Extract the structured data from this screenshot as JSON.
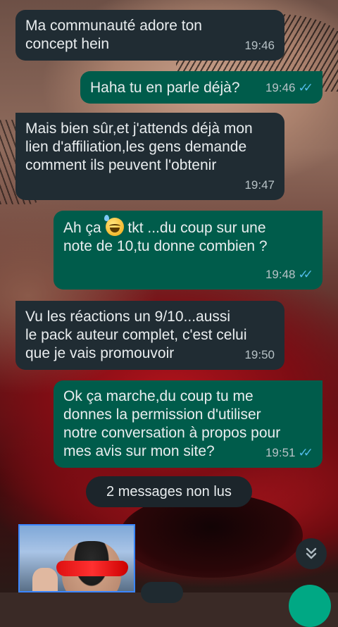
{
  "messages": [
    {
      "direction": "in",
      "text": "Ma communauté adore ton\nconcept hein",
      "time": "19:46"
    },
    {
      "direction": "out",
      "text": "Haha tu en parle déjà?",
      "time": "19:46",
      "status": "read"
    },
    {
      "direction": "in",
      "text": "Mais bien sûr,et j'attends déjà mon\nlien d'affiliation,les gens demande\ncomment ils peuvent l'obtenir",
      "time": "19:47"
    },
    {
      "direction": "out",
      "text_before_emoji": "Ah ça ",
      "emoji": "grinning-face-with-sweat",
      "text_after_emoji": " tkt ...du coup sur une\nnote de 10,tu donne combien ?",
      "time": "19:48",
      "status": "read"
    },
    {
      "direction": "in",
      "text": "Vu les réactions un 9/10...aussi\nle pack auteur complet, c'est celui\nque je vais promouvoir",
      "time": "19:50"
    },
    {
      "direction": "out",
      "text": "Ok ça marche,du coup tu me\ndonnes la permission d'utiliser\nnotre conversation à propos pour\nmes avis sur mon site?",
      "time": "19:51",
      "status": "read"
    }
  ],
  "unread_banner": "2 messages non lus",
  "icons": {
    "read_receipt": "double-check-icon",
    "scroll_down": "double-chevron-down-icon"
  },
  "colors": {
    "incoming_bubble": "#202c33",
    "outgoing_bubble": "#005c4b",
    "read_ticks": "#53bdeb",
    "accent": "#00a884"
  }
}
